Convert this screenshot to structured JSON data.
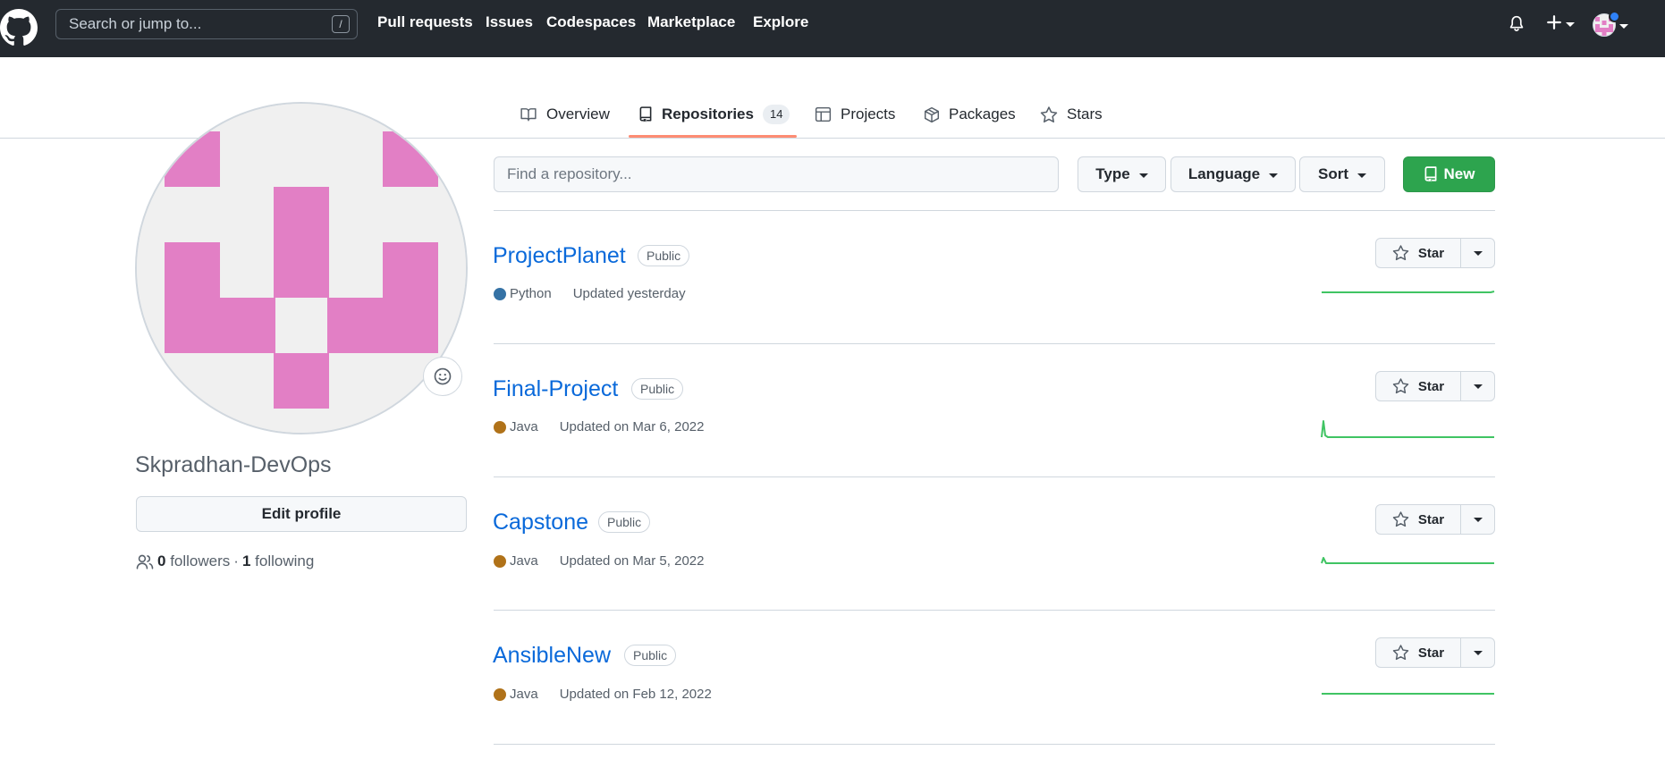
{
  "header": {
    "search_placeholder": "Search or jump to...",
    "search_hint_key": "/",
    "nav": [
      "Pull requests",
      "Issues",
      "Codespaces",
      "Marketplace",
      "Explore"
    ],
    "icons": [
      "github-logo-icon",
      "bell-icon",
      "plus-icon",
      "avatar-icon"
    ]
  },
  "tabs": [
    {
      "label": "Overview",
      "icon": "book-icon"
    },
    {
      "label": "Repositories",
      "icon": "repo-icon",
      "count": "14",
      "selected": true
    },
    {
      "label": "Projects",
      "icon": "table-icon"
    },
    {
      "label": "Packages",
      "icon": "package-icon"
    },
    {
      "label": "Stars",
      "icon": "star-icon"
    }
  ],
  "profile": {
    "username": "Skpradhan-DevOps",
    "edit_label": "Edit profile",
    "followers_count": "0",
    "followers_label": "followers",
    "separator": "·",
    "following_count": "1",
    "following_label": "following"
  },
  "filters": {
    "find_placeholder": "Find a repository...",
    "type_label": "Type",
    "language_label": "Language",
    "sort_label": "Sort",
    "new_label": "New"
  },
  "repos": [
    {
      "name": "ProjectPlanet",
      "visibility": "Public",
      "language": "Python",
      "language_color": "#3572A5",
      "updated": "Updated yesterday",
      "star_label": "Star"
    },
    {
      "name": "Final-Project",
      "visibility": "Public",
      "language": "Java",
      "language_color": "#b07219",
      "updated": "Updated on Mar 6, 2022",
      "star_label": "Star"
    },
    {
      "name": "Capstone",
      "visibility": "Public",
      "language": "Java",
      "language_color": "#b07219",
      "updated": "Updated on Mar 5, 2022",
      "star_label": "Star"
    },
    {
      "name": "AnsibleNew",
      "visibility": "Public",
      "language": "Java",
      "language_color": "#b07219",
      "updated": "Updated on Feb 12, 2022",
      "star_label": "Star"
    }
  ],
  "colors": {
    "header_bg": "#24292f",
    "link": "#0969da",
    "new_button": "#2da44e",
    "tab_underline": "#fd8c73",
    "identicon": "#e27fc5"
  }
}
